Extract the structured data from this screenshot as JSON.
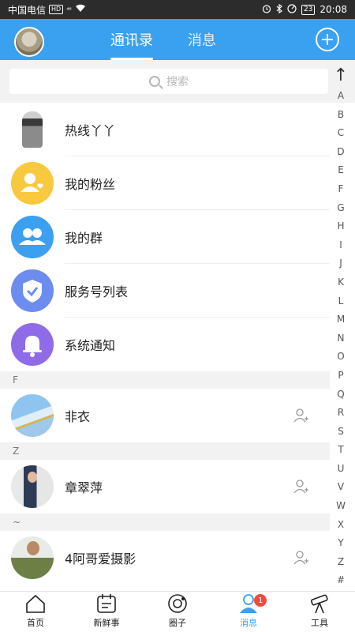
{
  "status_bar": {
    "carrier": "中国电信",
    "hd": "HD",
    "signal": "⁴⁶",
    "battery": "23",
    "time": "20:08"
  },
  "header": {
    "tabs": [
      {
        "label": "通讯录",
        "active": true
      },
      {
        "label": "消息",
        "active": false
      }
    ]
  },
  "search": {
    "placeholder": "搜索"
  },
  "fixed_items": [
    {
      "label": "热线丫丫",
      "icon": "person-avatar"
    },
    {
      "label": "我的粉丝",
      "icon": "fans-icon"
    },
    {
      "label": "我的群",
      "icon": "group-icon"
    },
    {
      "label": "服务号列表",
      "icon": "shield-icon"
    },
    {
      "label": "系统通知",
      "icon": "bell-icon"
    }
  ],
  "sections": [
    {
      "letter": "F",
      "contacts": [
        {
          "name": "非衣"
        }
      ]
    },
    {
      "letter": "Z",
      "contacts": [
        {
          "name": "章翠萍"
        }
      ]
    },
    {
      "letter": "~",
      "contacts": [
        {
          "name": "4阿哥爱摄影"
        }
      ]
    }
  ],
  "alphabet_index": [
    "A",
    "B",
    "C",
    "D",
    "E",
    "F",
    "G",
    "H",
    "I",
    "J",
    "K",
    "L",
    "M",
    "N",
    "O",
    "P",
    "Q",
    "R",
    "S",
    "T",
    "U",
    "V",
    "W",
    "X",
    "Y",
    "Z",
    "#"
  ],
  "bottom_nav": [
    {
      "label": "首页",
      "icon": "home-icon",
      "active": false
    },
    {
      "label": "新鲜事",
      "icon": "calendar-icon",
      "active": false
    },
    {
      "label": "圈子",
      "icon": "circle-icon",
      "active": false
    },
    {
      "label": "消息",
      "icon": "contacts-icon",
      "active": true,
      "badge": "1"
    },
    {
      "label": "工具",
      "icon": "telescope-icon",
      "active": false
    }
  ],
  "colors": {
    "primary": "#3aa0f0",
    "badge": "#f04a3a"
  }
}
